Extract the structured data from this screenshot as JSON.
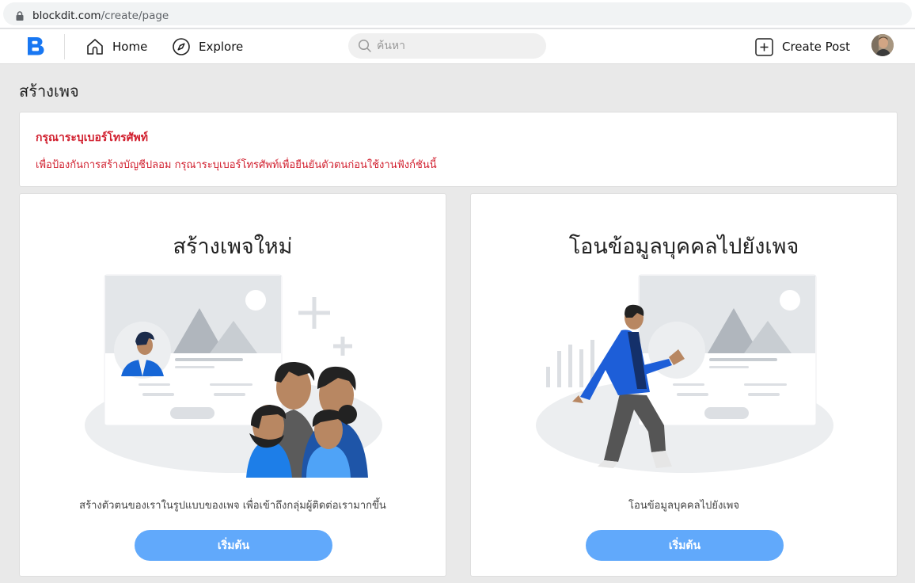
{
  "browser": {
    "url_host": "blockdit.com",
    "url_path": "/create/page"
  },
  "nav": {
    "home_label": "Home",
    "explore_label": "Explore",
    "search_placeholder": "ค้นหา",
    "create_post_label": "Create Post"
  },
  "page": {
    "title": "สร้างเพจ"
  },
  "alert": {
    "title": "กรุณาระบุเบอร์โทรศัพท์",
    "body": "เพื่อป้องกันการสร้างบัญชีปลอม กรุณาระบุเบอร์โทรศัพท์เพื่อยืนยันตัวตนก่อนใช้งานฟังก์ชันนี้"
  },
  "cards": [
    {
      "title": "สร้างเพจใหม่",
      "description": "สร้างตัวตนของเราในรูปแบบของเพจ เพื่อเข้าถึงกลุ่มผู้ติดต่อเรามากขึ้น",
      "button_label": "เริ่มต้น"
    },
    {
      "title": "โอนข้อมูลบุคคลไปยังเพจ",
      "description": "โอนข้อมูลบุคคลไปยังเพจ",
      "button_label": "เริ่มต้น"
    }
  ],
  "colors": {
    "brand": "#1877f2",
    "alert_red": "#d11f2e",
    "button_blue": "#61a9fb",
    "page_bg": "#e9e9e9"
  },
  "icons": {
    "lock": "lock-icon",
    "logo": "blockdit-logo",
    "home": "home-icon",
    "explore": "compass-icon",
    "search": "search-icon",
    "create_post": "plus-square-icon"
  }
}
